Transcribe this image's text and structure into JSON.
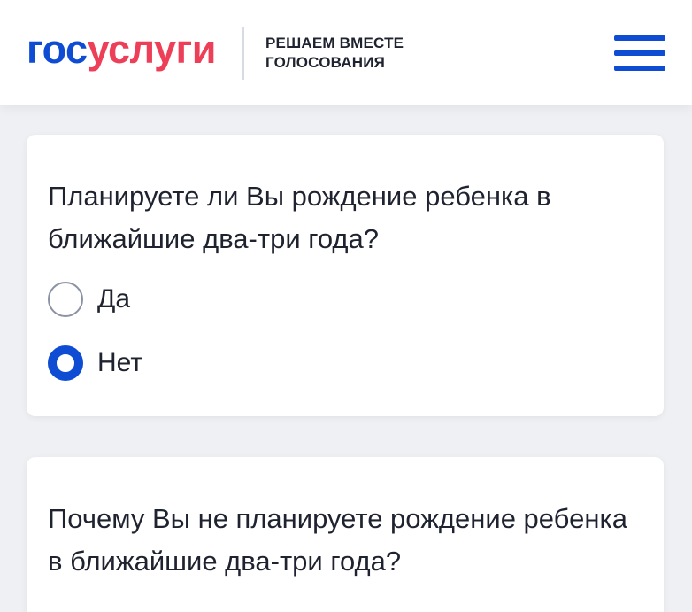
{
  "header": {
    "logo_part1": "гос",
    "logo_part2": "услуги",
    "subtitle_line1": "РЕШАЕМ ВМЕСТЕ",
    "subtitle_line2": "ГОЛОСОВАНИЯ",
    "menu_icon": "hamburger-menu-icon"
  },
  "questions": [
    {
      "text": "Планируете ли Вы рождение ребенка в ближайшие два-три года?",
      "options": [
        {
          "label": "Да",
          "selected": false
        },
        {
          "label": "Нет",
          "selected": true
        }
      ]
    },
    {
      "text": "Почему Вы не планируете рождение ребенка в ближайшие два-три года?"
    }
  ],
  "colors": {
    "brand_blue": "#0d4cd3",
    "brand_red": "#ee3f58",
    "background": "#eef0f4"
  }
}
